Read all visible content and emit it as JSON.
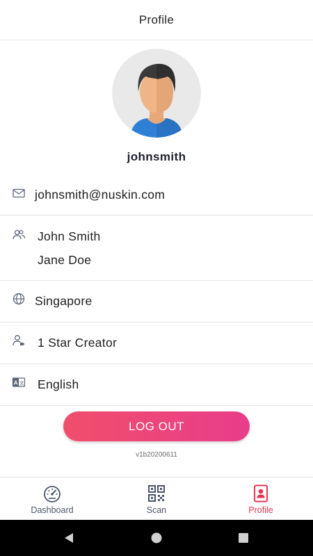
{
  "header": {
    "title": "Profile"
  },
  "profile": {
    "username": "johnsmith",
    "email": "johnsmith@nuskin.com",
    "names": [
      "John Smith",
      "Jane Doe"
    ],
    "country": "Singapore",
    "rank": "1 Star Creator",
    "language": "English"
  },
  "actions": {
    "logout_label": "LOG OUT"
  },
  "app": {
    "version": "v1b20200611"
  },
  "bottom_nav": {
    "items": [
      {
        "label": "Dashboard",
        "icon": "speedometer-icon",
        "active": false
      },
      {
        "label": "Scan",
        "icon": "qr-code-icon",
        "active": false
      },
      {
        "label": "Profile",
        "icon": "profile-card-icon",
        "active": true
      }
    ]
  },
  "colors": {
    "accent": "#e8344f",
    "logout_start": "#f04e6c",
    "logout_end": "#e83d8a",
    "icon_gray": "#5a6577"
  }
}
